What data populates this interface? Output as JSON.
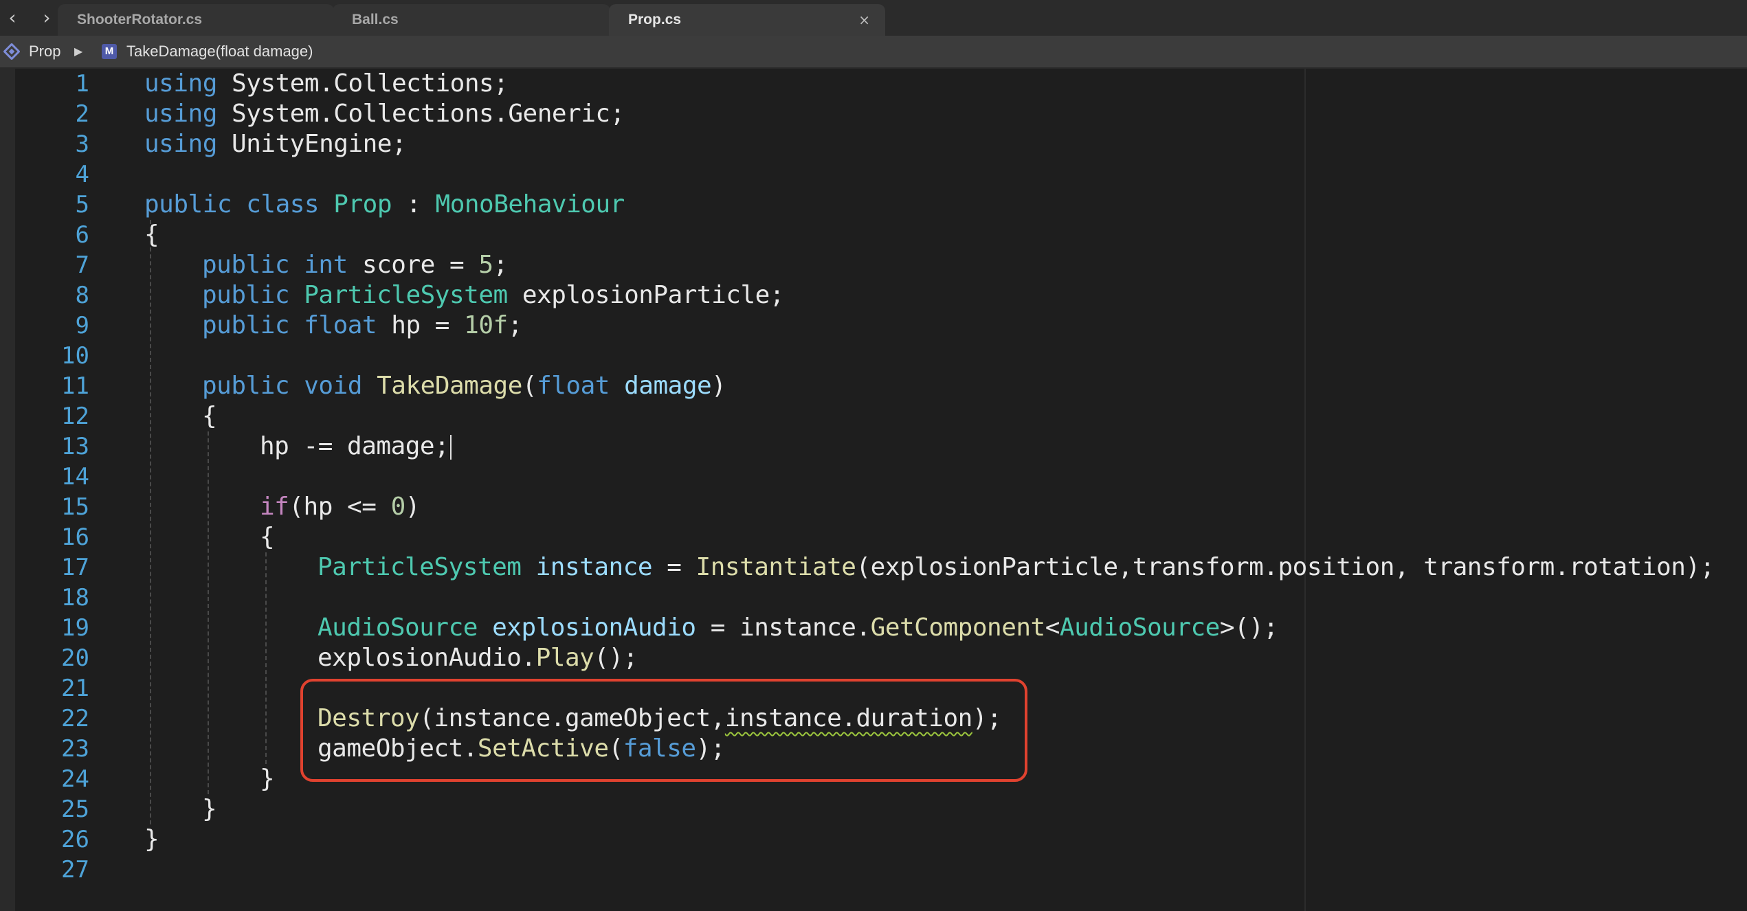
{
  "nav": {
    "back": "‹",
    "forward": "›"
  },
  "tabs": [
    {
      "label": "ShooterRotator.cs",
      "active": false
    },
    {
      "label": "Ball.cs",
      "active": false
    },
    {
      "label": "Prop.cs",
      "active": true,
      "close": "×"
    }
  ],
  "breadcrumb": {
    "class_label": "Prop",
    "separator": "▶",
    "method_icon_letter": "M",
    "method_label": "TakeDamage(float damage)"
  },
  "line_numbers": [
    "1",
    "2",
    "3",
    "4",
    "5",
    "6",
    "7",
    "8",
    "9",
    "10",
    "11",
    "12",
    "13",
    "14",
    "15",
    "16",
    "17",
    "18",
    "19",
    "20",
    "21",
    "22",
    "23",
    "24",
    "25",
    "26",
    "27"
  ],
  "code": {
    "l1": [
      "using",
      " System.Collections;"
    ],
    "l2": [
      "using",
      " System.Collections.Generic;"
    ],
    "l3": [
      "using",
      " UnityEngine;"
    ],
    "l5": [
      "public",
      " ",
      "class",
      " ",
      "Prop",
      " : ",
      "MonoBehaviour"
    ],
    "l6": [
      "{"
    ],
    "l7": [
      "public",
      " ",
      "int",
      " score = ",
      "5",
      ";"
    ],
    "l8": [
      "public",
      " ",
      "ParticleSystem",
      " explosionParticle;"
    ],
    "l9": [
      "public",
      " ",
      "float",
      " hp = ",
      "10f",
      ";"
    ],
    "l11": [
      "public",
      " ",
      "void",
      " ",
      "TakeDamage",
      "(",
      "float",
      " ",
      "damage",
      ")"
    ],
    "l12": [
      "{"
    ],
    "l13": [
      "hp -= damage;"
    ],
    "l15": [
      "if",
      "(hp <= ",
      "0",
      ")"
    ],
    "l16": [
      "{"
    ],
    "l17": [
      "ParticleSystem",
      " ",
      "instance",
      " = ",
      "Instantiate",
      "(explosionParticle,transform.position, transform.rotation);"
    ],
    "l19": [
      "AudioSource",
      " ",
      "explosionAudio",
      " = instance.",
      "GetComponent",
      "<",
      "AudioSource",
      ">();"
    ],
    "l20": [
      "explosionAudio.",
      "Play",
      "();"
    ],
    "l22": [
      "Destroy",
      "(instance.gameObject,",
      "instance.duration",
      ");"
    ],
    "l23": [
      "gameObject.",
      "SetActive",
      "(",
      "false",
      ");"
    ],
    "l24": [
      "}"
    ],
    "l25": [
      "}"
    ],
    "l26": [
      "}"
    ]
  },
  "colors": {
    "keyword": "#569cd6",
    "type": "#4ec9b0",
    "function": "#dcdcaa",
    "number": "#b5cea8",
    "control": "#c586c0",
    "parameter": "#9cdcfe",
    "line_number": "#4ea3d8",
    "highlight_box": "#e0422f"
  }
}
